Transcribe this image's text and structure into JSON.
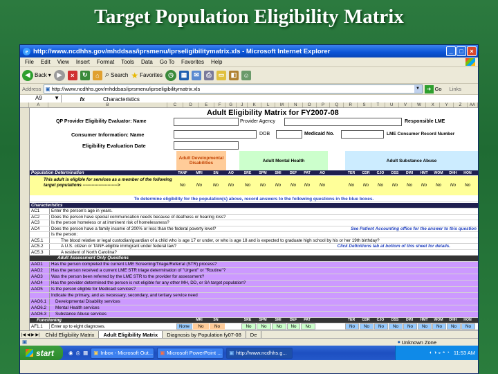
{
  "slide": {
    "title": "Target Population Eligibility Matrix"
  },
  "window": {
    "title": "http://www.ncdhhs.gov/mhddsas/iprsmenu/iprseligibilitymatrix.xls - Microsoft Internet Explorer",
    "menu": [
      "File",
      "Edit",
      "View",
      "Insert",
      "Format",
      "Tools",
      "Data",
      "Go To",
      "Favorites",
      "Help"
    ],
    "toolbar": {
      "back": "Back",
      "search": "Search",
      "favorites": "Favorites"
    },
    "address_label": "Address",
    "address": "http://www.ncdhhs.gov/mhddsas/iprsmenu/iprseligibilitymatrix.xls",
    "go": "Go",
    "links": "Links",
    "cell_ref": "A9",
    "fx": "fx",
    "formula": "Characteristics"
  },
  "columns": [
    "A",
    "B",
    "C",
    "D",
    "E",
    "F",
    "G",
    "J",
    "K",
    "L",
    "M",
    "N",
    "O",
    "P",
    "Q",
    "R",
    "S",
    "T",
    "U",
    "V",
    "W",
    "X",
    "Y",
    "Z",
    "AA"
  ],
  "matrix": {
    "title": "Adult Eligibility Matrix for FY2007-08",
    "qp_label": "QP Provider Eligibility Evaluator: Name",
    "provider_agency": "Provider Agency",
    "responsible_lme": "Responsible LME",
    "consumer_info": "Consumer Information: Name",
    "dob": "DOB",
    "medicaid": "Medicaid No.",
    "lme_record": "LME Consumer Record Number",
    "eval_date": "Eligibility Evaluation Date",
    "group_dd": "Adult Developmental Disabilities",
    "group_mh": "Adult Mental Health",
    "group_sa": "Adult Substance Abuse",
    "pop_det": "Population Determination",
    "abbr_dd": [
      "TANF",
      "MRI",
      "SN",
      "AO"
    ],
    "abbr_mh": [
      "SRE",
      "SPM",
      "SMI",
      "DEF",
      "PAT",
      "AO"
    ],
    "abbr_sa": [
      "TER",
      "CDR",
      "CJO",
      "DSS",
      "DWI",
      "HMT",
      "WOM",
      "DHH",
      "HON"
    ],
    "eligible_text": "This adult is eligible for services as a member of the following target populations ------------------------>",
    "no": "No",
    "instruction": "To determine eligibility for the population(s) above, record answers to the following questions in the blue boxes.",
    "characteristics": "Characteristics",
    "rows": [
      {
        "code": "AC1",
        "text": "Enter the person's age in years."
      },
      {
        "code": "AC2",
        "text": "Does the person have special communication needs because of deafness or hearing loss?"
      },
      {
        "code": "AC3",
        "text": "Is the person homeless or at imminent risk of homelessness?"
      },
      {
        "code": "AC4",
        "text": "Does the person have a family income of 200% or less than the federal poverty level?",
        "note": "See Patient Accounting office for the answer to this question"
      },
      {
        "code": "",
        "text": "Is the person:"
      },
      {
        "code": "AC5.1",
        "text": "The blood relative or legal custodian/guardian of a child who is age 17 or under, or who is age 18 and is expected to graduate high school by his or her 19th birthday?"
      },
      {
        "code": "AC5.2",
        "text": "A U.S. citizen or TANF-eligible immigrant under federal law?",
        "note": "Click Definitions tab at bottom of this sheet for details."
      },
      {
        "code": "AC5.3",
        "text": "A resident of North Carolina?"
      }
    ],
    "assessment_header": "Adult Assessment Only Questions",
    "assessment_rows": [
      {
        "code": "AAO1",
        "text": "Has the person completed the current LME Screening/Triage/Referral (STR) process?"
      },
      {
        "code": "AAO2",
        "text": "Has the person received a current LME STR triage determination of \"Urgent\" or \"Routine\"?"
      },
      {
        "code": "AAO3",
        "text": "Was the person been referred by the LME STR to the provider for assessment?"
      },
      {
        "code": "AAO4",
        "text": "Has the provider determined the person is not eligible for any other MH, DD, or SA target population?"
      },
      {
        "code": "AAO5",
        "text": "Is the person eligible for Medicaid services?"
      },
      {
        "code": "",
        "text": "Indicate the primary, and as necessary, secondary, and tertiary service need"
      },
      {
        "code": "AAO6.1",
        "text": "Developmental Disability services"
      },
      {
        "code": "AAO6.2",
        "text": "Mental Health services"
      },
      {
        "code": "AAO6.3",
        "text": "Substance Abuse services"
      }
    ],
    "functioning": "Functioning",
    "af_code": "AF1.1",
    "af_text": "Enter up to eight diagnoses.",
    "none": "None"
  },
  "tabs": [
    "Child Eligibility Matrix",
    "Adult Eligibility Matrix",
    "Diagnosis by Population fy07-08",
    "De"
  ],
  "status": {
    "zone": "Unknown Zone"
  },
  "taskbar": {
    "start": "start",
    "tasks": [
      "Inbox - Microsoft Out...",
      "Microsoft PowerPoint ...",
      "http://www.ncdhhs.g..."
    ],
    "clock": "11:53 AM"
  }
}
